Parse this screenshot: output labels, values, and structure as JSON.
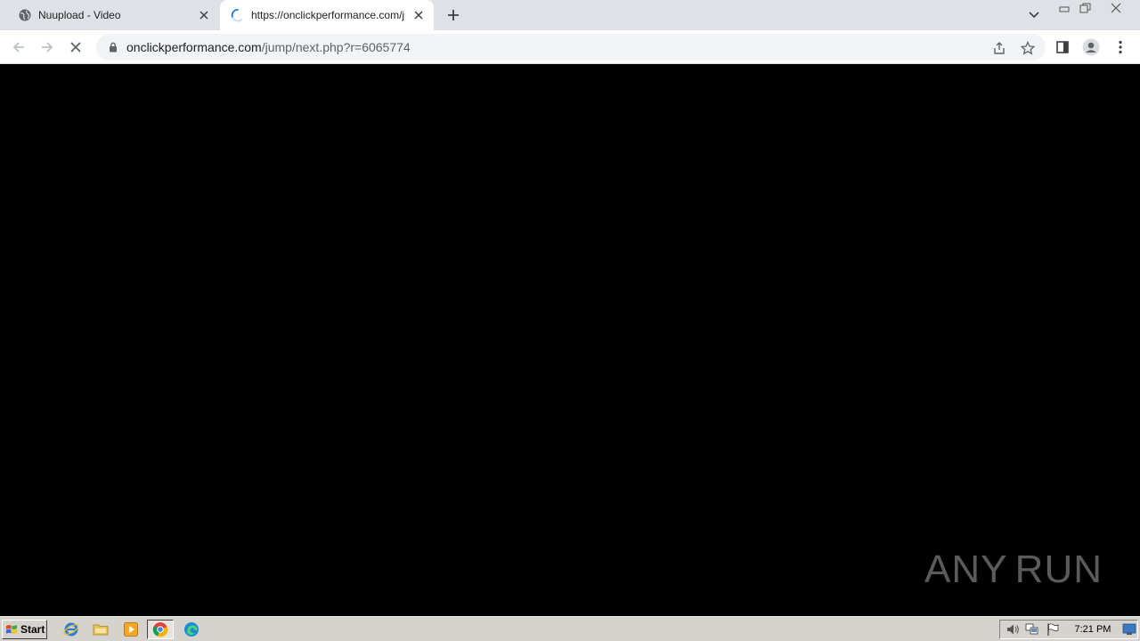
{
  "browser": {
    "tabs": [
      {
        "title": "Nuupload - Video",
        "icon": "globe-icon",
        "active": false
      },
      {
        "title": "https://onclickperformance.com/jump",
        "icon": "loading-spinner-icon",
        "active": true
      }
    ],
    "address_bar": {
      "host": "onclickperformance.com",
      "path": "/jump/next.php?r=6065774"
    }
  },
  "watermark": {
    "left_text": "ANY",
    "right_text": "RUN"
  },
  "taskbar": {
    "start_label": "Start",
    "clock": "7:21 PM",
    "apps": [
      "internet-explorer-icon",
      "file-explorer-icon",
      "media-player-icon",
      "chrome-icon",
      "edge-icon"
    ]
  },
  "colors": {
    "tabstrip": "#dee1e6",
    "content": "#000000",
    "taskbar": "#d6d3ce",
    "accent_blue": "#1a73e8"
  }
}
